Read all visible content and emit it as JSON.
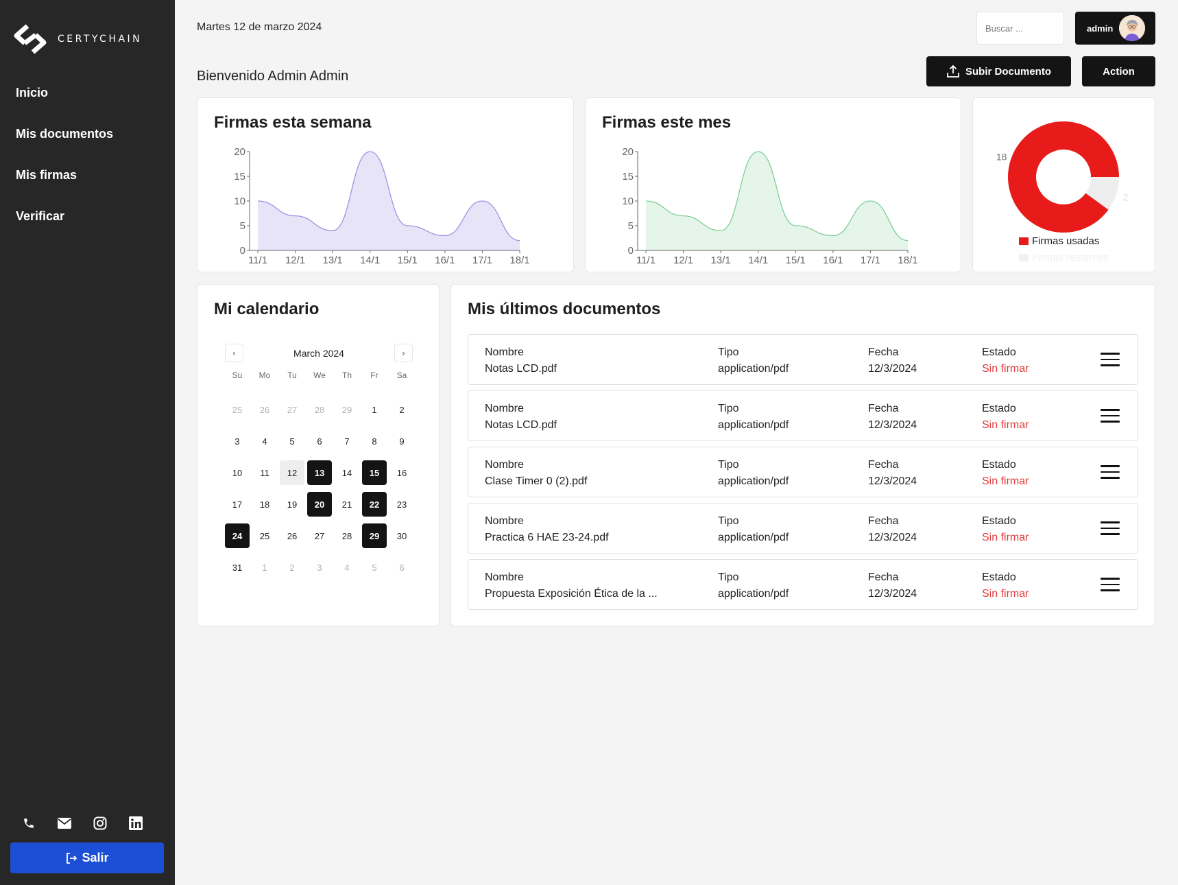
{
  "brand": {
    "name": "CERTYCHAIN"
  },
  "sidebar": {
    "items": [
      {
        "label": "Inicio"
      },
      {
        "label": "Mis documentos"
      },
      {
        "label": "Mis firmas"
      },
      {
        "label": "Verificar"
      }
    ],
    "social_icons": [
      "phone-icon",
      "mail-icon",
      "instagram-icon",
      "linkedin-icon"
    ],
    "logout_label": "Salir"
  },
  "header": {
    "date": "Martes 12 de marzo 2024",
    "welcome": "Bienvenido Admin Admin",
    "search_placeholder": "Buscar ...",
    "user_label": "admin",
    "upload_label": "Subir Documento",
    "action_label": "Action"
  },
  "week_card": {
    "title": "Firmas esta semana"
  },
  "month_card": {
    "title": "Firmas este mes"
  },
  "calendar": {
    "title": "Mi calendario",
    "month_label": "March 2024",
    "weekdays": [
      "Su",
      "Mo",
      "Tu",
      "We",
      "Th",
      "Fr",
      "Sa"
    ],
    "weeks": [
      [
        {
          "d": "25",
          "m": true
        },
        {
          "d": "26",
          "m": true
        },
        {
          "d": "27",
          "m": true
        },
        {
          "d": "28",
          "m": true
        },
        {
          "d": "29",
          "m": true
        },
        {
          "d": "1"
        },
        {
          "d": "2"
        }
      ],
      [
        {
          "d": "3"
        },
        {
          "d": "4"
        },
        {
          "d": "5"
        },
        {
          "d": "6"
        },
        {
          "d": "7"
        },
        {
          "d": "8"
        },
        {
          "d": "9"
        }
      ],
      [
        {
          "d": "10"
        },
        {
          "d": "11"
        },
        {
          "d": "12",
          "t": true
        },
        {
          "d": "13",
          "s": true
        },
        {
          "d": "14"
        },
        {
          "d": "15",
          "s": true
        },
        {
          "d": "16"
        }
      ],
      [
        {
          "d": "17"
        },
        {
          "d": "18"
        },
        {
          "d": "19"
        },
        {
          "d": "20",
          "s": true
        },
        {
          "d": "21"
        },
        {
          "d": "22",
          "s": true
        },
        {
          "d": "23"
        }
      ],
      [
        {
          "d": "24",
          "s": true
        },
        {
          "d": "25"
        },
        {
          "d": "26"
        },
        {
          "d": "27"
        },
        {
          "d": "28"
        },
        {
          "d": "29",
          "s": true
        },
        {
          "d": "30"
        }
      ],
      [
        {
          "d": "31"
        },
        {
          "d": "1",
          "m": true
        },
        {
          "d": "2",
          "m": true
        },
        {
          "d": "3",
          "m": true
        },
        {
          "d": "4",
          "m": true
        },
        {
          "d": "5",
          "m": true
        },
        {
          "d": "6",
          "m": true
        }
      ]
    ]
  },
  "documents": {
    "title": "Mis últimos documentos",
    "labels": {
      "name": "Nombre",
      "type": "Tipo",
      "date": "Fecha",
      "status": "Estado"
    },
    "rows": [
      {
        "name": "Notas LCD.pdf",
        "type": "application/pdf",
        "date": "12/3/2024",
        "status": "Sin firmar"
      },
      {
        "name": "Notas LCD.pdf",
        "type": "application/pdf",
        "date": "12/3/2024",
        "status": "Sin firmar"
      },
      {
        "name": "Clase Timer 0 (2).pdf",
        "type": "application/pdf",
        "date": "12/3/2024",
        "status": "Sin firmar"
      },
      {
        "name": "Practica 6 HAE 23-24.pdf",
        "type": "application/pdf",
        "date": "12/3/2024",
        "status": "Sin firmar"
      },
      {
        "name": "Propuesta Exposición Ética de la ...",
        "type": "application/pdf",
        "date": "12/3/2024",
        "status": "Sin firmar"
      }
    ]
  },
  "colors": {
    "week_line": "#9b93e0",
    "week_fill": "#e7e4f8",
    "month_line": "#7ccf95",
    "month_fill": "#e6f5ea",
    "pie_used": "#e81b1b",
    "pie_remaining": "#eeeeee",
    "accent": "#1d4fd6"
  },
  "chart_data": [
    {
      "type": "area",
      "categories": [
        "11/1",
        "12/1",
        "13/1",
        "14/1",
        "15/1",
        "16/1",
        "17/1",
        "18/1"
      ],
      "values": [
        10,
        7,
        4,
        20,
        5,
        3,
        10,
        2
      ],
      "yticks": [
        "0",
        "5",
        "10",
        "15",
        "20"
      ],
      "ylim": [
        0,
        20
      ]
    },
    {
      "type": "area",
      "categories": [
        "11/1",
        "12/1",
        "13/1",
        "14/1",
        "15/1",
        "16/1",
        "17/1",
        "18/1"
      ],
      "values": [
        10,
        7,
        4,
        20,
        5,
        3,
        10,
        2
      ],
      "yticks": [
        "0",
        "5",
        "10",
        "15",
        "20"
      ],
      "ylim": [
        0,
        20
      ]
    },
    {
      "type": "pie",
      "labels": [
        "Firmas usadas",
        "Firmas restantes"
      ],
      "values": [
        18,
        2
      ],
      "value_labels": [
        "18",
        "2"
      ],
      "legend": "bottom"
    }
  ]
}
